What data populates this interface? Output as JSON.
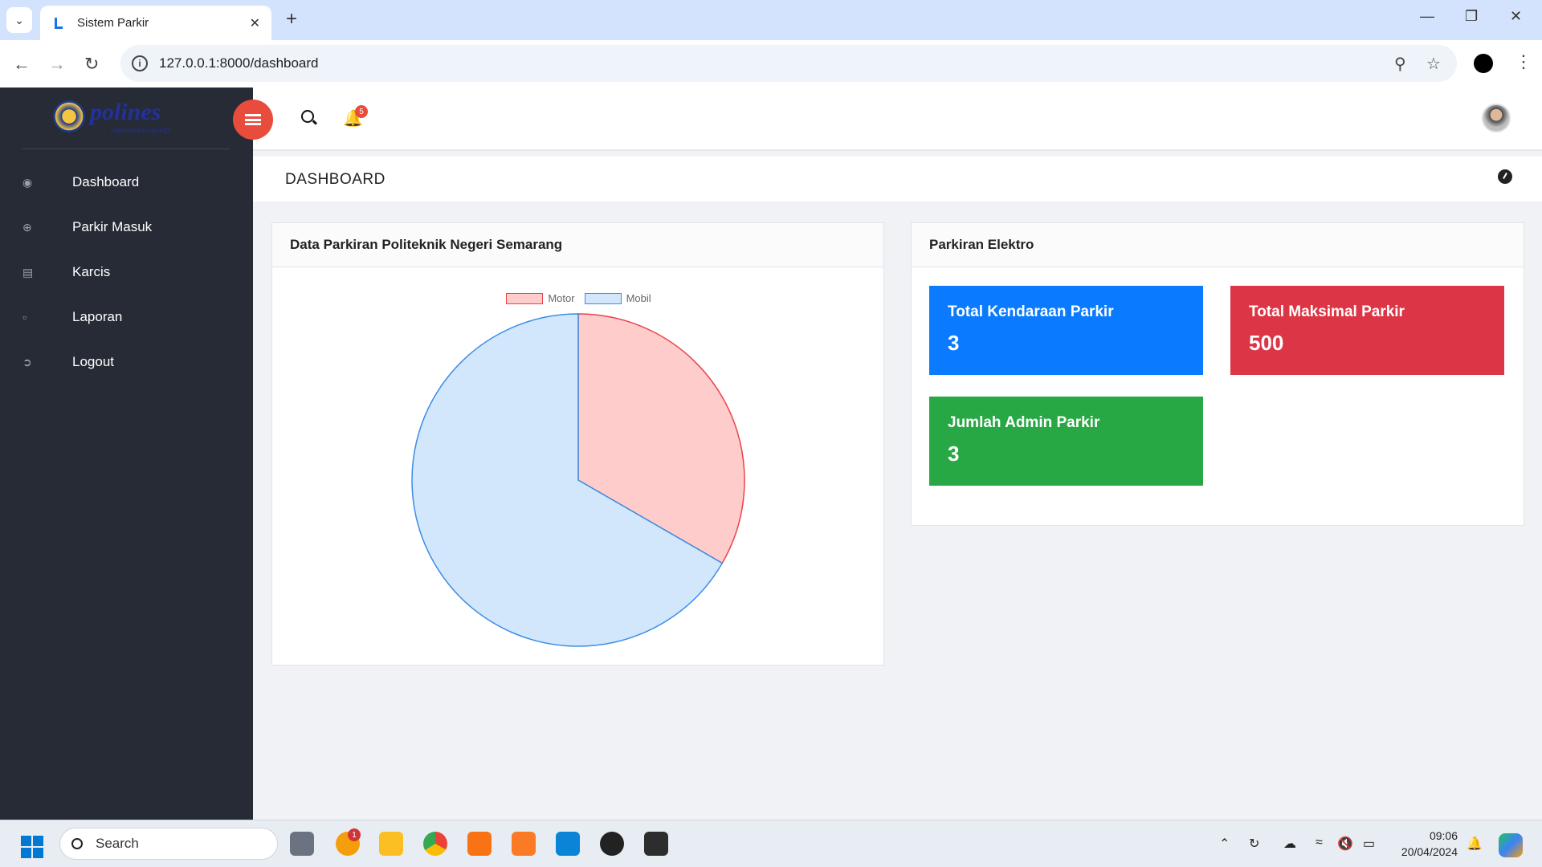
{
  "browser": {
    "tab_title": "Sistem Parkir",
    "url": "127.0.0.1:8000/dashboard"
  },
  "sidebar": {
    "logo_text": "polines",
    "logo_tagline": "committed to quality",
    "items": [
      {
        "label": "Dashboard",
        "icon": "palette-icon"
      },
      {
        "label": "Parkir Masuk",
        "icon": "plus-circle-icon"
      },
      {
        "label": "Karcis",
        "icon": "ticket-icon"
      },
      {
        "label": "Laporan",
        "icon": "document-icon"
      },
      {
        "label": "Logout",
        "icon": "logout-icon"
      }
    ]
  },
  "topnav": {
    "notification_count": "5"
  },
  "page": {
    "title": "DASHBOARD"
  },
  "chart_card": {
    "title": "Data Parkiran Politeknik Negeri Semarang"
  },
  "chart_data": {
    "type": "pie",
    "categories": [
      "Motor",
      "Mobil"
    ],
    "values": [
      1,
      2
    ],
    "colors": [
      "#ffcccc",
      "#d2e7fb"
    ],
    "border_colors": [
      "#e8434b",
      "#3a8ee6"
    ],
    "legend_position": "top"
  },
  "info_card": {
    "title": "Parkiran Elektro",
    "stats": [
      {
        "label": "Total Kendaraan Parkir",
        "value": "3",
        "color": "#0a7bff"
      },
      {
        "label": "Total Maksimal Parkir",
        "value": "500",
        "color": "#dc3545"
      },
      {
        "label": "Jumlah Admin Parkir",
        "value": "3",
        "color": "#28a745"
      }
    ]
  },
  "taskbar": {
    "search_placeholder": "Search",
    "app_badge": "1",
    "time": "09:06",
    "date": "20/04/2024"
  }
}
